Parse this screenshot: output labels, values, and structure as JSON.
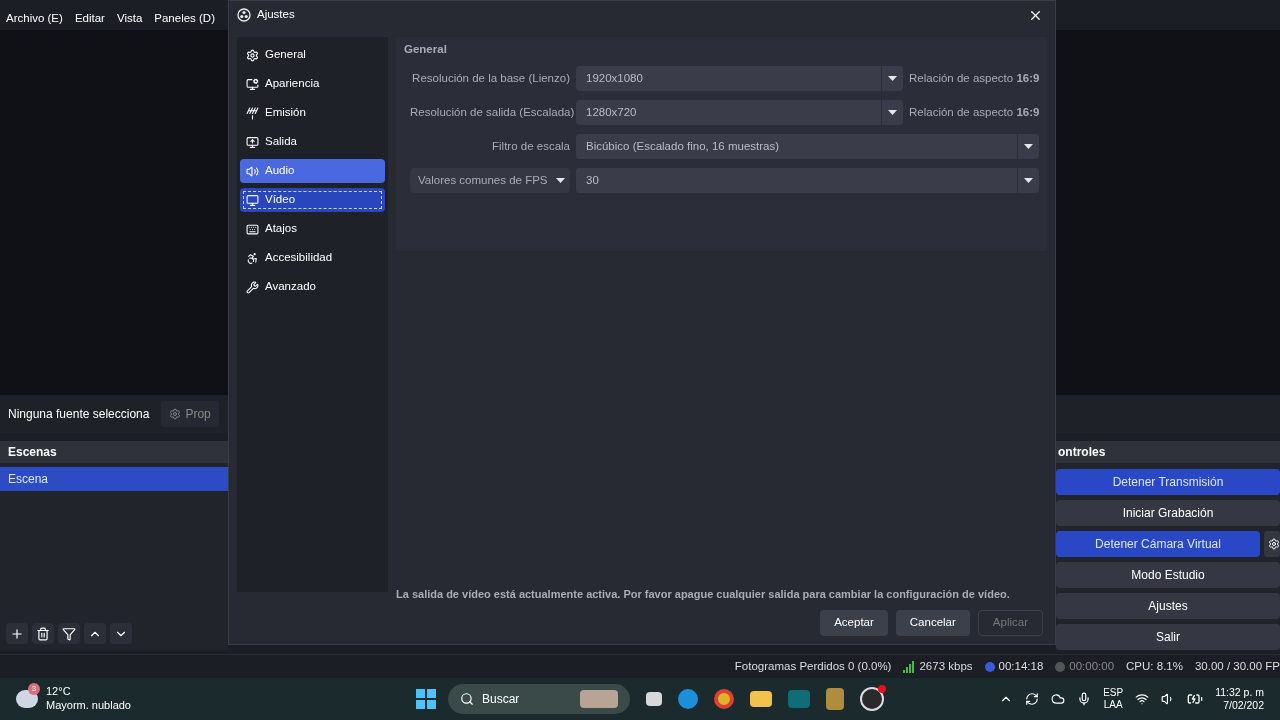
{
  "menu": [
    "Archivo (E)",
    "Editar",
    "Vista",
    "Paneles (D)"
  ],
  "source_bar": {
    "label": "Ninguna fuente selecciona",
    "button": "Prop"
  },
  "scenes": {
    "title": "Escenas",
    "items": [
      {
        "name": "Escena",
        "selected": true
      }
    ]
  },
  "controls": {
    "title": "ontroles",
    "buttons": [
      {
        "label": "Detener Transmisión",
        "active": true,
        "gear": false
      },
      {
        "label": "Iniciar Grabación",
        "active": false,
        "gear": false
      },
      {
        "label": "Detener Cámara Virtual",
        "active": true,
        "gear": true
      },
      {
        "label": "Modo Estudio",
        "active": false,
        "gear": false
      },
      {
        "label": "Ajustes",
        "active": false,
        "gear": false
      },
      {
        "label": "Salir",
        "active": false,
        "gear": false
      }
    ]
  },
  "dialog": {
    "title": "Ajustes",
    "nav": [
      {
        "label": "General",
        "selected": false,
        "hovered": false
      },
      {
        "label": "Apariencia",
        "selected": false,
        "hovered": false
      },
      {
        "label": "Emisión",
        "selected": false,
        "hovered": false
      },
      {
        "label": "Salida",
        "selected": false,
        "hovered": false
      },
      {
        "label": "Audio",
        "selected": false,
        "hovered": true
      },
      {
        "label": "Vídeo",
        "selected": true,
        "hovered": false
      },
      {
        "label": "Atajos",
        "selected": false,
        "hovered": false
      },
      {
        "label": "Accesibilidad",
        "selected": false,
        "hovered": false
      },
      {
        "label": "Avanzado",
        "selected": false,
        "hovered": false
      }
    ],
    "section": "General",
    "rows": [
      {
        "kind": "select",
        "label": "Resolución de la base (Lienzo)",
        "value": "1920x1080",
        "note": "Relación de aspecto **16:9**"
      },
      {
        "kind": "select",
        "label": "Resolución de salida (Escalada)",
        "value": "1280x720",
        "note": "Relación de aspecto **16:9**"
      },
      {
        "kind": "select",
        "label": "Filtro de escala",
        "value": "Bicúbico (Escalado fino, 16 muestras)"
      },
      {
        "kind": "dropdown-label",
        "label": "Valores comunes de FPS",
        "value": "30"
      }
    ],
    "message": "La salida de vídeo está actualmente activa. Por favor apague cualquier salida para cambiar la configuración de vídeo.",
    "buttons": [
      {
        "label": "Aceptar",
        "disabled": false
      },
      {
        "label": "Cancelar",
        "disabled": false
      },
      {
        "label": "Aplicar",
        "disabled": true
      }
    ]
  },
  "status_bar": {
    "dropped": "Fotogramas Perdidos 0 (0.0%)",
    "bitrate": "2673 kbps",
    "stream_time": "00:14:18",
    "record_time": "00:00:00",
    "cpu": "CPU: 8.1%",
    "fps": "30.00 / 30.00 FP"
  },
  "taskbar": {
    "weather_badge": "3",
    "temperature": "12°C",
    "condition": "Mayorm. nublado",
    "search": "Buscar",
    "lang": "ESP",
    "layout": "LAA",
    "time": "11:32 p. m",
    "date": "7/02/202"
  }
}
